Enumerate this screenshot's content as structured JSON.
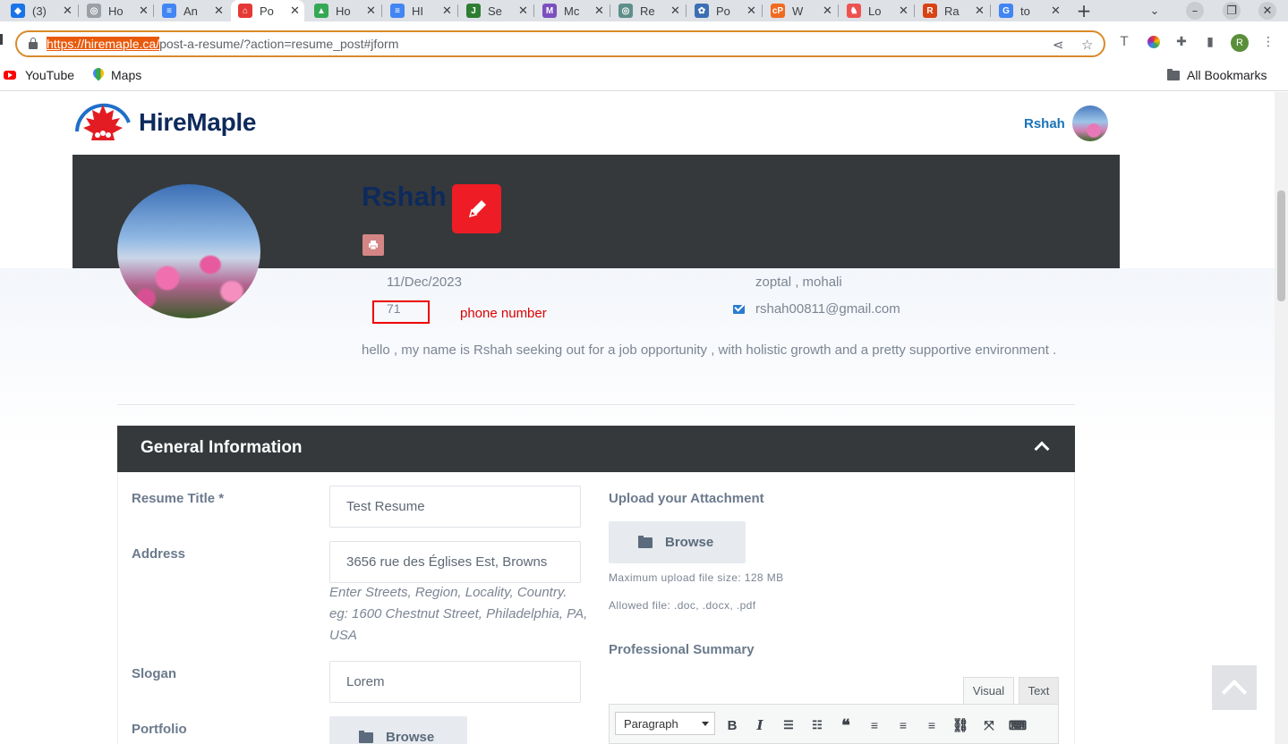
{
  "browser": {
    "tabs": [
      {
        "label": "(3)",
        "color": "#1a73e8",
        "glyph": "◆"
      },
      {
        "label": "Ho",
        "color": "#9aa0a6",
        "glyph": "◎"
      },
      {
        "label": "An",
        "color": "#4285f4",
        "glyph": "≡"
      },
      {
        "label": "Po",
        "color": "#e53935",
        "glyph": "⌂"
      },
      {
        "label": "Ho",
        "color": "#34a853",
        "glyph": "▲"
      },
      {
        "label": "HI",
        "color": "#4285f4",
        "glyph": "≡"
      },
      {
        "label": "Se",
        "color": "#2e7d32",
        "glyph": "J"
      },
      {
        "label": "Mc",
        "color": "#7b4fbf",
        "glyph": "M"
      },
      {
        "label": "Re",
        "color": "#5f8f8a",
        "glyph": "◎"
      },
      {
        "label": "Po",
        "color": "#3b6fb5",
        "glyph": "✿"
      },
      {
        "label": "W",
        "color": "#f06a20",
        "glyph": "cP"
      },
      {
        "label": "Lo",
        "color": "#ef5350",
        "glyph": "♞"
      },
      {
        "label": "Ra",
        "color": "#d84315",
        "glyph": "R"
      },
      {
        "label": "to",
        "color": "#4285f4",
        "glyph": "G"
      }
    ],
    "active_tab_index": 3,
    "url_highlight": "https://hiremaple.ca/",
    "url_rest": "post-a-resume/?action=resume_post#jform",
    "profile_initial": "R",
    "bookmarks": [
      {
        "label": "YouTube",
        "icon": "youtube-icon"
      },
      {
        "label": "Maps",
        "icon": "maps-icon"
      }
    ],
    "all_bookmarks": "All Bookmarks"
  },
  "site": {
    "logo_text": "HireMaple",
    "header_user": "Rshah"
  },
  "profile": {
    "name": "Rshah",
    "date": "11/Dec/2023",
    "location": "zoptal , mohali",
    "phone": "71",
    "phone_note": "phone number",
    "email": "rshah00811@gmail.com",
    "bio": "hello , my name is Rshah seeking out for a job opportunity , with holistic growth  and a pretty supportive environment ."
  },
  "section": {
    "title": "General Information"
  },
  "form": {
    "resume_title_label": "Resume Title *",
    "resume_title_value": "Test Resume",
    "address_label": "Address",
    "address_value": "3656 rue des Églises Est, Browns",
    "address_hint": "Enter Streets, Region, Locality, Country. eg: 1600 Chestnut Street, Philadelphia, PA, USA",
    "slogan_label": "Slogan",
    "slogan_value": "Lorem",
    "portfolio_label": "Portfolio",
    "portfolio_browse": "Browse",
    "upload_label": "Upload your Attachment",
    "upload_browse": "Browse",
    "max_size": "Maximum upload file size: 128 MB",
    "allowed": "Allowed file: .doc, .docx, .pdf",
    "summary_label": "Professional Summary",
    "editor_visual": "Visual",
    "editor_text": "Text",
    "paragraph": "Paragraph"
  }
}
